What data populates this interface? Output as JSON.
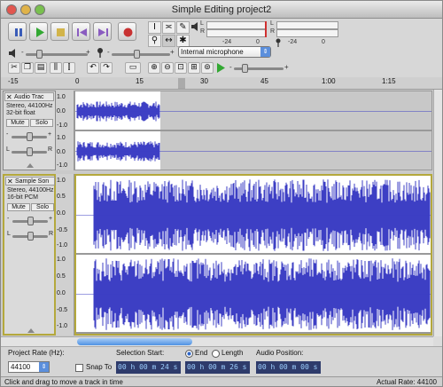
{
  "window": {
    "title": "Simple Editing project2"
  },
  "transport": {
    "buttons": [
      "pause",
      "play",
      "stop",
      "skip-to-start",
      "skip-to-end",
      "record"
    ]
  },
  "meters": {
    "L": "L",
    "R": "R",
    "play_ticks": [
      "-24",
      "0"
    ],
    "rec_ticks": [
      "-24",
      "0"
    ]
  },
  "mixer": {
    "minus": "-",
    "plus": "+",
    "input_device": "Internal microphone"
  },
  "ruler": {
    "labels": [
      "-15",
      "0",
      "15",
      "30",
      "45",
      "1:00",
      "1:15"
    ]
  },
  "tracks": [
    {
      "name": "Audio Trac",
      "info1": "Stereo, 44100Hz",
      "info2": "32-bit float",
      "mute": "Mute",
      "solo": "Solo",
      "minus": "-",
      "plus": "+",
      "left": "L",
      "right": "R",
      "scale_top": [
        "1.0",
        "0.0",
        "-1.0"
      ],
      "scale_bottom": [
        "1.0",
        "0.0",
        "-1.0"
      ]
    },
    {
      "name": "Sample Son",
      "info1": "Stereo, 44100Hz",
      "info2": "16-bit PCM",
      "mute": "Mute",
      "solo": "Solo",
      "minus": "-",
      "plus": "+",
      "left": "L",
      "right": "R",
      "scale_top": [
        "1.0",
        "0.5",
        "0.0",
        "-0.5",
        "-1.0"
      ],
      "scale_bottom": [
        "1.0",
        "0.5",
        "0.0",
        "-0.5",
        "-1.0"
      ]
    }
  ],
  "selection": {
    "project_rate_label": "Project Rate (Hz):",
    "project_rate": "44100",
    "snap_to": "Snap To",
    "selection_start_label": "Selection Start:",
    "start_time": "00 h 00 m 24 s",
    "end_label": "End",
    "length_label": "Length",
    "end_time": "00 h 00 m 26 s",
    "audio_position_label": "Audio Position:",
    "audio_position": "00 h 00 m 00 s"
  },
  "status": {
    "message": "Click and drag to move a track in time",
    "actual_rate": "Actual Rate: 44100"
  },
  "colors": {
    "waveform": "#3d3fc4",
    "selection": "#c8c8c8",
    "play": "#32a832",
    "record": "#c83232"
  }
}
